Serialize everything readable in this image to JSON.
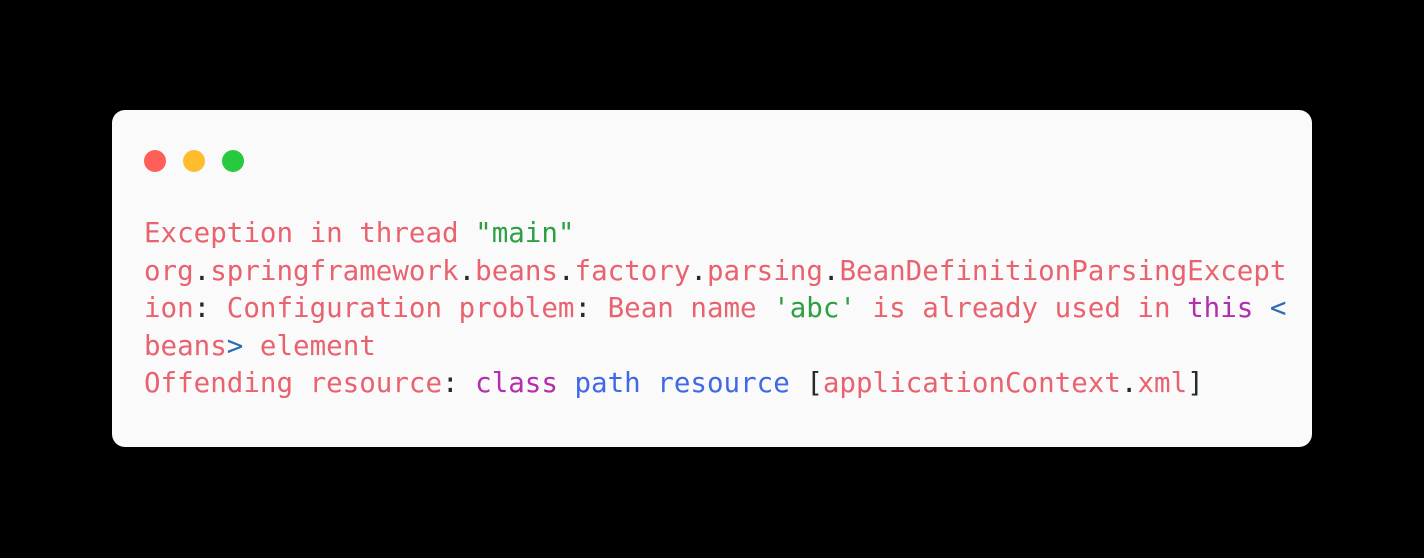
{
  "window": {
    "controls": [
      {
        "name": "close",
        "label": "Close",
        "color": "#FF5F56"
      },
      {
        "name": "minimize",
        "label": "Minimize",
        "color": "#FFBD2E"
      },
      {
        "name": "maximize",
        "label": "Maximize",
        "color": "#27C93F"
      }
    ],
    "background": "#FAFAFA",
    "page_background": "#000000"
  },
  "theme": {
    "error": "#E8636F",
    "string": "#2EA043",
    "keyword": "#B32EAF",
    "identifier": "#4069E5",
    "tag": "#2B6CB0",
    "punctuation": "#24292E"
  },
  "code": {
    "language": "java-stacktrace",
    "plain_text": "Exception in thread \"main\" org.springframework.beans.factory.parsing.BeanDefinitionParsingException: Configuration problem: Bean name 'abc' is already used in this <beans> element\nOffending resource: class path resource [applicationContext.xml]",
    "lines": [
      {
        "id": "line-1",
        "tokens": [
          {
            "text": "Exception in thread ",
            "type": "error"
          },
          {
            "text": "\"main\"",
            "type": "string"
          }
        ]
      },
      {
        "id": "line-2",
        "tokens": [
          {
            "text": "org",
            "type": "error"
          },
          {
            "text": ".",
            "type": "punctuation"
          },
          {
            "text": "springframework",
            "type": "error"
          },
          {
            "text": ".",
            "type": "punctuation"
          },
          {
            "text": "beans",
            "type": "error"
          },
          {
            "text": ".",
            "type": "punctuation"
          },
          {
            "text": "factory",
            "type": "error"
          },
          {
            "text": ".",
            "type": "punctuation"
          },
          {
            "text": "parsing",
            "type": "error"
          },
          {
            "text": ".",
            "type": "punctuation"
          },
          {
            "text": "BeanDefinitionParsingException",
            "type": "error"
          },
          {
            "text": ":",
            "type": "punctuation"
          },
          {
            "text": " Configuration problem",
            "type": "error"
          },
          {
            "text": ":",
            "type": "punctuation"
          },
          {
            "text": " Bean name ",
            "type": "error"
          },
          {
            "text": "'abc'",
            "type": "string"
          },
          {
            "text": " is already used in ",
            "type": "error"
          },
          {
            "text": "this",
            "type": "keyword"
          },
          {
            "text": " ",
            "type": "error"
          },
          {
            "text": "<",
            "type": "tag"
          },
          {
            "text": "beans",
            "type": "error"
          },
          {
            "text": ">",
            "type": "tag"
          },
          {
            "text": " element",
            "type": "error"
          }
        ]
      },
      {
        "id": "line-3",
        "tokens": [
          {
            "text": "Offending resource",
            "type": "error"
          },
          {
            "text": ":",
            "type": "punctuation"
          },
          {
            "text": " ",
            "type": "error"
          },
          {
            "text": "class",
            "type": "keyword"
          },
          {
            "text": " ",
            "type": "error"
          },
          {
            "text": "path",
            "type": "identifier"
          },
          {
            "text": " ",
            "type": "error"
          },
          {
            "text": "resource",
            "type": "identifier"
          },
          {
            "text": " ",
            "type": "error"
          },
          {
            "text": "[",
            "type": "punctuation"
          },
          {
            "text": "applicationContext",
            "type": "error"
          },
          {
            "text": ".",
            "type": "punctuation"
          },
          {
            "text": "xml",
            "type": "error"
          },
          {
            "text": "]",
            "type": "punctuation"
          }
        ]
      }
    ]
  }
}
